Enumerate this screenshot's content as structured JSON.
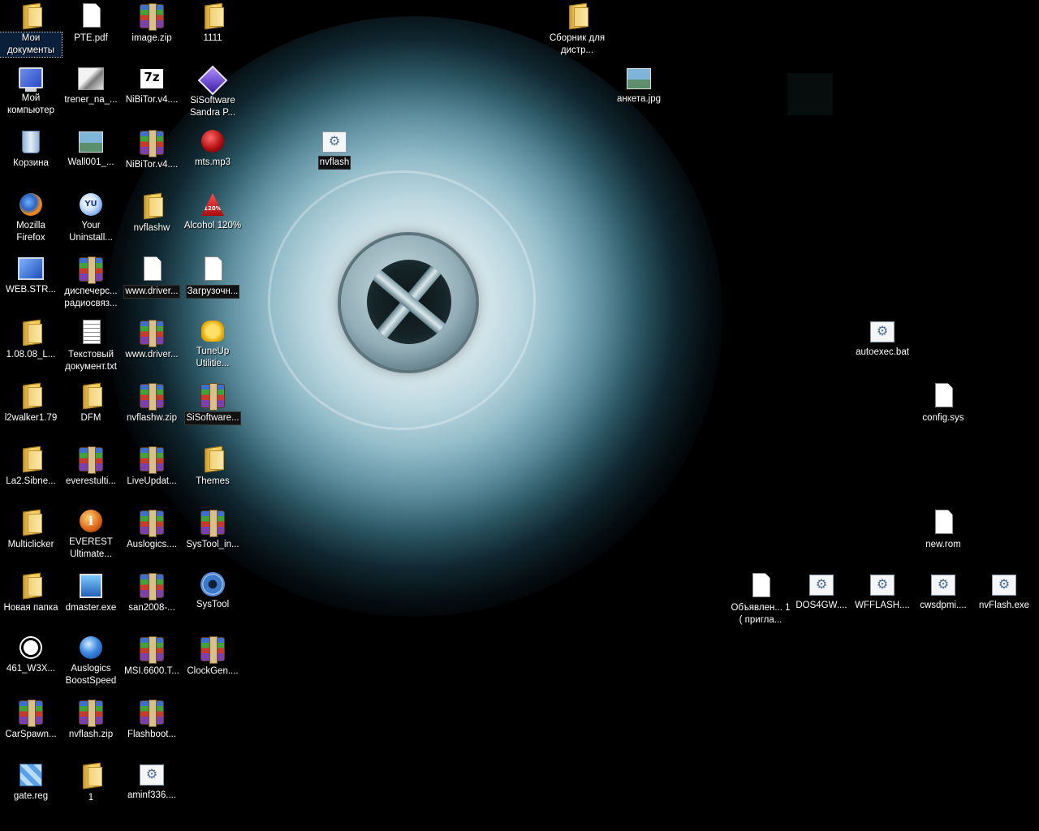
{
  "desktop": {
    "icons": [
      {
        "label": "Мои документы",
        "icon": "folder-icon"
      },
      {
        "label": "PTE.pdf",
        "icon": "document-icon"
      },
      {
        "label": "image.zip",
        "icon": "winrar-archive-icon"
      },
      {
        "label": "1111",
        "icon": "folder-icon"
      },
      {
        "label": "Сборник для дистр...",
        "icon": "folder-icon"
      },
      {
        "label": "Мой компьютер",
        "icon": "my-computer-icon"
      },
      {
        "label": "trener_na_...",
        "icon": "image-file-icon"
      },
      {
        "label": "NiBiTor.v4....",
        "icon": "7zip-archive-icon"
      },
      {
        "label": "SiSoftware Sandra P...",
        "icon": "sisoftware-sandra-icon"
      },
      {
        "label": "анкета.jpg",
        "icon": "image-file-icon"
      },
      {
        "label": "Корзина",
        "icon": "recycle-bin-icon"
      },
      {
        "label": "Wall001_...",
        "icon": "image-file-icon"
      },
      {
        "label": "NiBiTor.v4....",
        "icon": "winrar-archive-icon"
      },
      {
        "label": "mts.mp3",
        "icon": "mp3-file-icon"
      },
      {
        "label": "nvflash",
        "icon": "settings-file-icon"
      },
      {
        "label": "Mozilla Firefox",
        "icon": "firefox-icon"
      },
      {
        "label": "Your Uninstall...",
        "icon": "your-uninstaller-icon"
      },
      {
        "label": "nvflashw",
        "icon": "folder-icon"
      },
      {
        "label": "Alcohol 120%",
        "icon": "alcohol-120-icon"
      },
      {
        "label": "WEB.STR...",
        "icon": "network-icon"
      },
      {
        "label": "диспечерс... радиосвяз...",
        "icon": "winrar-archive-icon"
      },
      {
        "label": "www.driver...",
        "icon": "document-icon"
      },
      {
        "label": "Загрузочн...",
        "icon": "document-icon"
      },
      {
        "label": "1.08.08_L...",
        "icon": "folder-icon"
      },
      {
        "label": "Текстовый документ.txt",
        "icon": "text-file-icon"
      },
      {
        "label": "www.driver...",
        "icon": "winrar-archive-icon"
      },
      {
        "label": "TuneUp Utilitie...",
        "icon": "tuneup-utilities-icon"
      },
      {
        "label": "autoexec.bat",
        "icon": "settings-file-icon"
      },
      {
        "label": "l2walker1.79",
        "icon": "folder-icon"
      },
      {
        "label": "DFM",
        "icon": "folder-icon"
      },
      {
        "label": "nvflashw.zip",
        "icon": "winrar-archive-icon"
      },
      {
        "label": "SiSoftware...",
        "icon": "winrar-archive-icon"
      },
      {
        "label": "config.sys",
        "icon": "document-icon"
      },
      {
        "label": "La2.Sibne...",
        "icon": "folder-icon"
      },
      {
        "label": "everestulti...",
        "icon": "winrar-archive-icon"
      },
      {
        "label": "LiveUpdat...",
        "icon": "winrar-archive-icon"
      },
      {
        "label": "Themes",
        "icon": "folder-icon"
      },
      {
        "label": "Multiclicker",
        "icon": "folder-icon"
      },
      {
        "label": "EVEREST Ultimate...",
        "icon": "everest-icon"
      },
      {
        "label": "Auslogics....",
        "icon": "winrar-archive-icon"
      },
      {
        "label": "SysTool_in...",
        "icon": "winrar-archive-icon"
      },
      {
        "label": "new.rom",
        "icon": "document-icon"
      },
      {
        "label": "Новая папка",
        "icon": "folder-icon"
      },
      {
        "label": "dmaster.exe",
        "icon": "dmaster-icon"
      },
      {
        "label": "san2008-...",
        "icon": "winrar-archive-icon"
      },
      {
        "label": "SysTool",
        "icon": "gear-icon"
      },
      {
        "label": "Объявлен... 1 ( пригла...",
        "icon": "document-icon"
      },
      {
        "label": "DOS4GW....",
        "icon": "settings-file-icon"
      },
      {
        "label": "WFFLASH....",
        "icon": "settings-file-icon"
      },
      {
        "label": "cwsdpmi....",
        "icon": "settings-file-icon"
      },
      {
        "label": "nvFlash.exe",
        "icon": "settings-file-icon"
      },
      {
        "label": "461_W3X...",
        "icon": "yin-yang-icon"
      },
      {
        "label": "Auslogics BoostSpeed",
        "icon": "globe-icon"
      },
      {
        "label": "MSI.6600.T...",
        "icon": "winrar-archive-icon"
      },
      {
        "label": "ClockGen....",
        "icon": "winrar-archive-icon"
      },
      {
        "label": "CarSpawn...",
        "icon": "winrar-archive-icon"
      },
      {
        "label": "nvflash.zip",
        "icon": "winrar-archive-icon"
      },
      {
        "label": "Flashboot...",
        "icon": "winrar-archive-icon"
      },
      {
        "label": "gate.reg",
        "icon": "registry-file-icon"
      },
      {
        "label": "1",
        "icon": "folder-icon"
      },
      {
        "label": "aminf336....",
        "icon": "settings-file-icon"
      }
    ]
  }
}
